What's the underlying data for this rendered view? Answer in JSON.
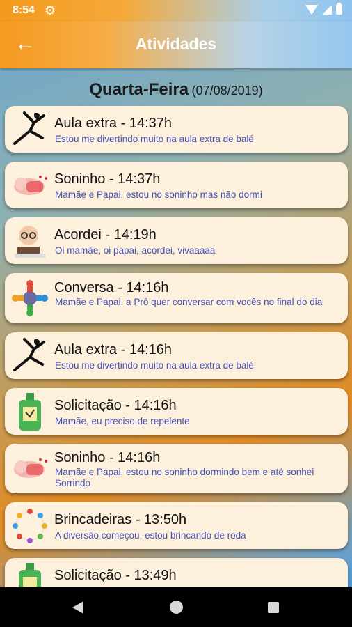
{
  "status": {
    "time": "8:54"
  },
  "appbar": {
    "title": "Atividades"
  },
  "day": {
    "name": "Quarta-Feira",
    "date": "(07/08/2019)"
  },
  "activities": [
    {
      "title": "Aula extra - 14:37h",
      "desc": "Estou me divertindo muito na aula extra de  balé",
      "icon": "ballet-dancer-icon"
    },
    {
      "title": "Soninho - 14:37h",
      "desc": "Mamãe e Papai, estou no soninho  mas não dormi",
      "icon": "sleeping-baby-icon"
    },
    {
      "title": "Acordei - 14:19h",
      "desc": "Oi mamãe, oi papai,  acordei, vivaaaaa",
      "icon": "baby-reading-icon"
    },
    {
      "title": "Conversa - 14:16h",
      "desc": "Mamãe e Papai, a Prô quer conversar com vocês no final do dia",
      "icon": "conversation-people-icon"
    },
    {
      "title": "Aula extra - 14:16h",
      "desc": "Estou me divertindo muito na aula extra de  balé",
      "icon": "ballet-dancer-icon"
    },
    {
      "title": "Solicitação - 14:16h",
      "desc": "Mamãe, eu preciso de  repelente",
      "icon": "repellent-bottle-icon"
    },
    {
      "title": "Soninho - 14:16h",
      "desc": "Mamãe e Papai, estou no soninho  dormindo bem  e até sonhei Sorrindo",
      "icon": "sleeping-baby-icon"
    },
    {
      "title": "Brincadeiras  - 13:50h",
      "desc": "A diversão começou, estou brincando  de roda",
      "icon": "children-circle-icon"
    },
    {
      "title": "Solicitação - 13:49h",
      "desc": "",
      "icon": "repellent-bottle-icon"
    }
  ]
}
